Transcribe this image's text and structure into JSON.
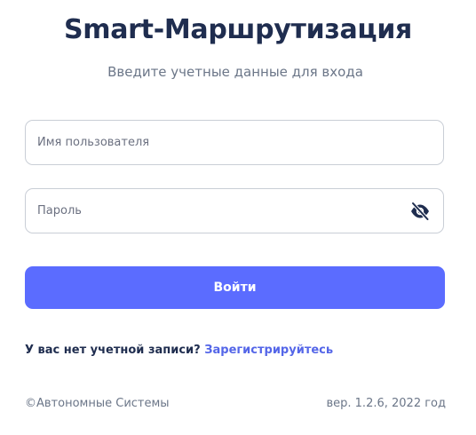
{
  "header": {
    "title": "Smart-Маршрутизация",
    "subtitle": "Введите учетные данные для входа"
  },
  "form": {
    "username_placeholder": "Имя пользователя",
    "username_value": "",
    "password_placeholder": "Пароль",
    "password_value": "",
    "password_toggle_icon": "eye-off-icon",
    "submit_label": "Войти"
  },
  "register": {
    "prompt": "У вас нет учетной записи?",
    "link_label": "Зарегистрируйтесь"
  },
  "footer": {
    "copyright": "©Автономные Системы",
    "version": "вер. 1.2.6, 2022 год"
  },
  "colors": {
    "title": "#1f2d4f",
    "accent": "#5b6cff",
    "link": "#5466e8",
    "muted": "#6b7688",
    "border": "#c9ced6"
  }
}
